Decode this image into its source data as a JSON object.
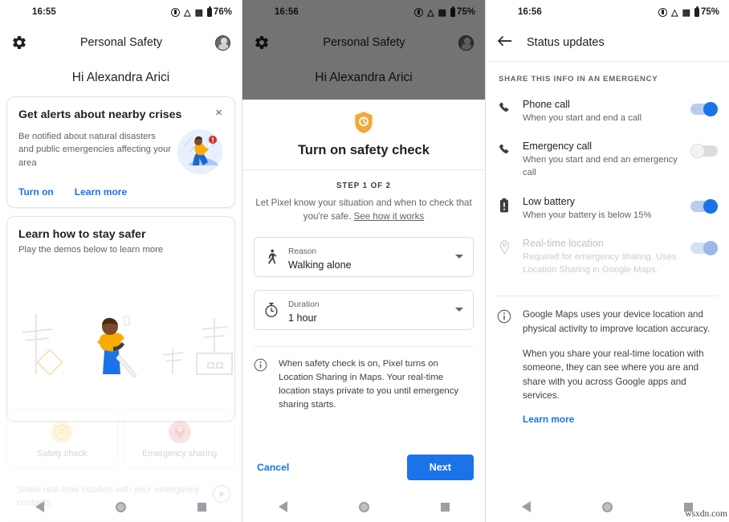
{
  "screen1": {
    "statusbar": {
      "time": "16:55",
      "battery": "76%",
      "icons": [
        "vibrate-icon",
        "wifi-icon",
        "cell-signal-icon",
        "battery-icon"
      ]
    },
    "appbar": {
      "title": "Personal Safety",
      "settings_icon": "gear-icon",
      "avatar": "account-avatar"
    },
    "greeting": "Hi Alexandra Arici",
    "alert_card": {
      "title": "Get alerts about nearby crises",
      "description": "Be notified about natural disasters and public emergencies affecting your area",
      "close_label": "×",
      "actions": [
        {
          "label": "Turn on"
        },
        {
          "label": "Learn more"
        }
      ]
    },
    "learn_card": {
      "title": "Learn how to stay safer",
      "subtitle": "Play the demos below to learn more"
    },
    "tiles": [
      {
        "label": "Safety check",
        "icon": "safety-check-shield-icon",
        "color": "#fbe7a2"
      },
      {
        "label": "Emergency sharing",
        "icon": "emergency-sharing-icon",
        "color": "#e79b9b"
      }
    ],
    "ghost_text": "Share real-time location with your emergency contacts",
    "play_icon": "play-circle-icon"
  },
  "screen2": {
    "statusbar": {
      "time": "16:56",
      "battery": "75%"
    },
    "appbar": {
      "title": "Personal Safety"
    },
    "greeting": "Hi Alexandra Arici",
    "sheet": {
      "hero_icon": "safety-check-shield-icon",
      "title": "Turn on safety check",
      "step": "STEP 1 OF 2",
      "description": "Let Pixel know your situation and when to check that you're safe.",
      "description_link": "See how it works",
      "fields": [
        {
          "icon": "walking-person-icon",
          "label": "Reason",
          "value": "Walking alone"
        },
        {
          "icon": "timer-icon",
          "label": "Duration",
          "value": "1 hour"
        }
      ],
      "note_icon": "info-icon",
      "note": "When safety check is on, Pixel turns on Location Sharing in Maps. Your real-time location stays private to you until emergency sharing starts.",
      "cancel_label": "Cancel",
      "next_label": "Next",
      "accent": "#1a73e8"
    }
  },
  "screen3": {
    "statusbar": {
      "time": "16:56",
      "battery": "75%"
    },
    "appbar": {
      "title": "Status updates",
      "back_icon": "arrow-left-icon"
    },
    "section_header": "SHARE THIS INFO IN AN EMERGENCY",
    "rows": [
      {
        "icon": "phone-icon",
        "title": "Phone call",
        "subtitle": "When you start and end a call",
        "state": "on",
        "disabled": false
      },
      {
        "icon": "phone-icon",
        "title": "Emergency call",
        "subtitle": "When you start and end an emergency call",
        "state": "off",
        "disabled": false
      },
      {
        "icon": "battery-alert-icon",
        "title": "Low battery",
        "subtitle": "When your battery is below 15%",
        "state": "on",
        "disabled": false
      },
      {
        "icon": "location-pin-icon",
        "title": "Real-time location",
        "subtitle": "Required for emergency sharing. Uses Location Sharing in Google Maps.",
        "state": "on",
        "disabled": true
      }
    ],
    "info": {
      "icon": "info-icon",
      "paragraphs": [
        "Google Maps uses your device location and physical activity to improve location accuracy.",
        "When you share your real-time location with someone, they can see where you are and share with you across Google apps and services."
      ],
      "link": "Learn more"
    }
  },
  "navbar": {
    "back": "back-triangle-icon",
    "home": "home-circle-icon",
    "recents": "recents-square-icon"
  },
  "watermark": "wsxdn.com"
}
